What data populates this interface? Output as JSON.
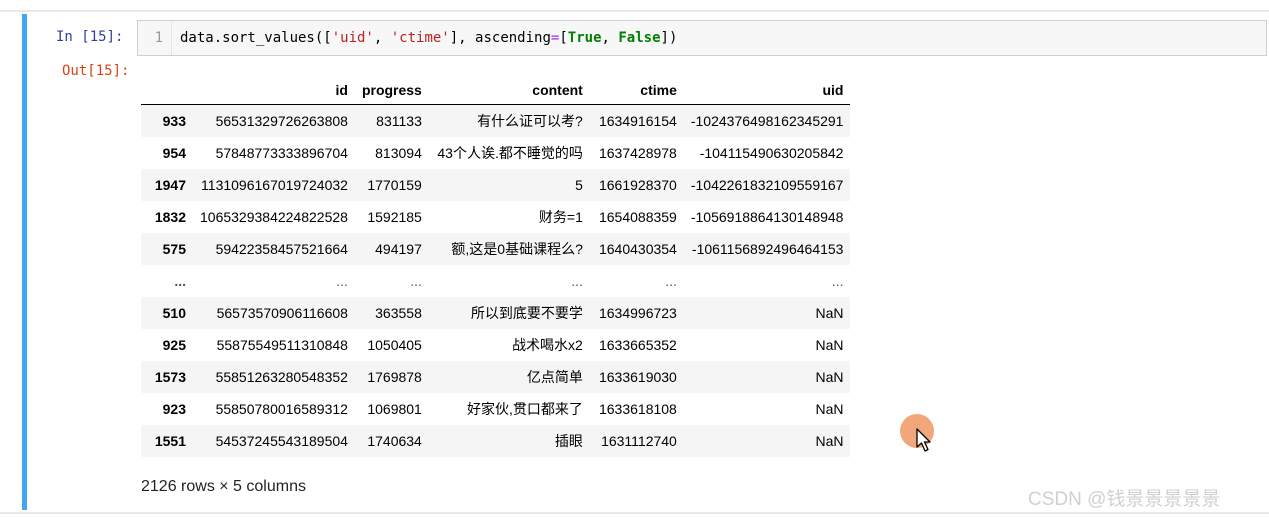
{
  "cell": {
    "in_prompt": "In  [15]:",
    "out_prompt": "Out[15]:",
    "line_number": "1",
    "code": {
      "p1": "data.sort_values([",
      "s1": "'uid'",
      "p2": ", ",
      "s2": "'ctime'",
      "p3": "], ascending",
      "op": "=",
      "p4": "[",
      "k1": "True",
      "p5": ", ",
      "k2": "False",
      "p6": "])"
    }
  },
  "table": {
    "columns": [
      "",
      "id",
      "progress",
      "content",
      "ctime",
      "uid"
    ],
    "rows": [
      [
        "933",
        "56531329726263808",
        "831133",
        "有什么证可以考?",
        "1634916154",
        "-1024376498162345291"
      ],
      [
        "954",
        "57848773333896704",
        "813094",
        "43个人诶.都不睡觉的吗",
        "1637428978",
        "-104115490630205842"
      ],
      [
        "1947",
        "1131096167019724032",
        "1770159",
        "5",
        "1661928370",
        "-1042261832109559167"
      ],
      [
        "1832",
        "1065329384224822528",
        "1592185",
        "财务=1",
        "1654088359",
        "-1056918864130148948"
      ],
      [
        "575",
        "59422358457521664",
        "494197",
        "额,这是0基础课程么?",
        "1640430354",
        "-1061156892496464153"
      ],
      [
        "...",
        "...",
        "...",
        "...",
        "...",
        "..."
      ],
      [
        "510",
        "56573570906116608",
        "363558",
        "所以到底要不要学",
        "1634996723",
        "NaN"
      ],
      [
        "925",
        "55875549511310848",
        "1050405",
        "战术喝水x2",
        "1633665352",
        "NaN"
      ],
      [
        "1573",
        "55851263280548352",
        "1769878",
        "亿点简单",
        "1633619030",
        "NaN"
      ],
      [
        "923",
        "55850780016589312",
        "1069801",
        "好家伙,贯口都来了",
        "1633618108",
        "NaN"
      ],
      [
        "1551",
        "54537245543189504",
        "1740634",
        "插眼",
        "1631112740",
        "NaN"
      ]
    ],
    "shape": "2126 rows × 5 columns"
  },
  "watermark": "CSDN @钱景景景景景",
  "colors": {
    "cell_border": "#42a5f5",
    "in_prompt": "#303f9f",
    "out_prompt": "#d84315",
    "string": "#ba2121",
    "keyword": "#008000",
    "operator": "#aa22ff"
  }
}
